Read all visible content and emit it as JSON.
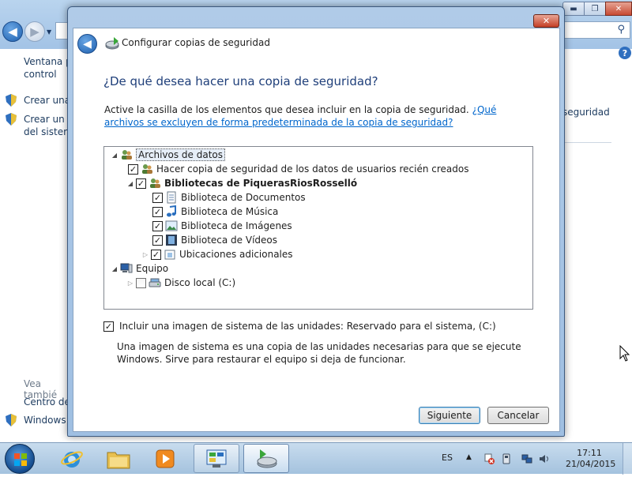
{
  "background_window": {
    "left_pane": {
      "item1": "Ventana pr",
      "item1_line2": "control",
      "item2": "Crear una i",
      "item3": "Crear un d",
      "item3_line2": "del sistema",
      "see_also": "Vea tambié",
      "item4": "Centro de",
      "item5": "Windows E"
    },
    "right_text": "seguridad"
  },
  "dialog": {
    "title": "Configurar copias de seguridad",
    "heading": "¿De qué desea hacer una copia de seguridad?",
    "instruction": "Active la casilla de los elementos que desea incluir en la copia de seguridad.",
    "instruction_link": "¿Qué archivos se excluyen de forma predeterminada de la copia de seguridad?",
    "tree": {
      "data_files": "Archivos de datos",
      "new_users": "Hacer copia de seguridad de los datos de usuarios recién creados",
      "libraries": "Bibliotecas de PiquerasRiosRosselló",
      "documents": "Biblioteca de Documentos",
      "music": "Biblioteca de Música",
      "images": "Biblioteca de Imágenes",
      "videos": "Biblioteca de Vídeos",
      "additional": "Ubicaciones adicionales",
      "computer": "Equipo",
      "local_disk": "Disco local (C:)"
    },
    "system_image_label": "Incluir una imagen de sistema de las unidades: Reservado para el sistema, (C:)",
    "system_image_desc": "Una imagen de sistema es una copia de las unidades necesarias para que se ejecute Windows. Sirve para restaurar el equipo si deja de funcionar.",
    "next_button": "Siguiente",
    "cancel_button": "Cancelar"
  },
  "taskbar": {
    "language": "ES",
    "time": "17:11",
    "date": "21/04/2015"
  }
}
